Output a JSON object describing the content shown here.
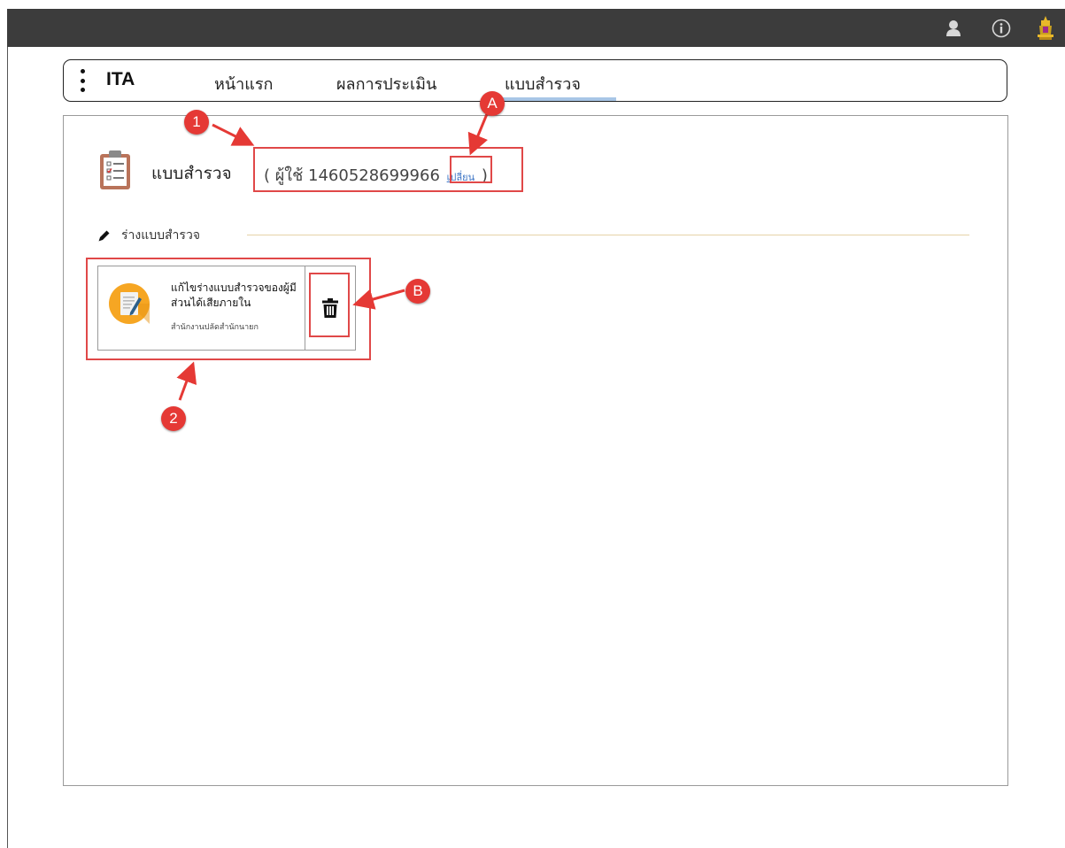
{
  "topbar": {
    "icons": [
      "user-icon",
      "info-icon",
      "crest-logo-icon"
    ],
    "background": "#3c3c3c"
  },
  "nav": {
    "brand": "ITA",
    "tabs": [
      {
        "label": "หน้าแรก"
      },
      {
        "label": "ผลการประเมิน"
      },
      {
        "label": "แบบสำรวจ",
        "active": true
      }
    ],
    "active_underline_color": "#a8c6e6"
  },
  "page": {
    "heading": "แบบสำรวจ",
    "user_prefix": "( ผู้ใช้ 1460528699966",
    "change_link": "เปลี่ยน",
    "user_suffix": ")"
  },
  "section": {
    "title": "ร่างแบบสำรวจ",
    "icon": "pencil-icon"
  },
  "draft_card": {
    "title": "แก้ไขร่างแบบสำรวจของผู้มีส่วนได้เสียภายใน",
    "subtitle": "สำนักงานปลัดสำนักนายก",
    "icon": "document-edit-icon",
    "delete_icon": "trash-icon",
    "avatar_color": "#f6a623"
  },
  "annotations": {
    "badges": [
      "1",
      "2",
      "A",
      "B"
    ],
    "color": "#e53935"
  }
}
